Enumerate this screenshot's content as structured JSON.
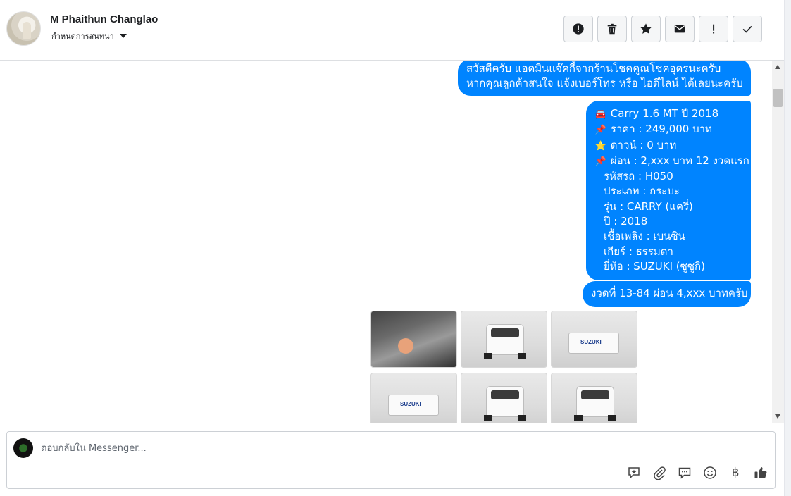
{
  "header": {
    "contact_name": "M Phaithun Changlao",
    "assign_label": "กำหนดการสนทนา"
  },
  "actions": [
    {
      "name": "report-spam-button",
      "icon": "alert-circle-icon"
    },
    {
      "name": "delete-button",
      "icon": "trash-icon"
    },
    {
      "name": "star-button",
      "icon": "star-icon"
    },
    {
      "name": "mark-unread-button",
      "icon": "envelope-icon"
    },
    {
      "name": "important-button",
      "icon": "exclamation-icon"
    },
    {
      "name": "mark-done-button",
      "icon": "check-icon"
    }
  ],
  "messages": {
    "greeting": [
      "สวัสดีครับ แอดมินแจ๊คกี้จากร้านโชคคูณโชคอุดรนะครับ",
      "หากคุณลูกค้าสนใจ แจ้งเบอร์โทร หรือ ไอดีไลน์ ได้เลยนะครับ"
    ],
    "listing": [
      {
        "emoji": "🚘",
        "text": "Carry 1.6 MT  ปี 2018"
      },
      {
        "emoji": "📌",
        "text": "ราคา : 249,000 บาท"
      },
      {
        "emoji": "⭐",
        "text": "ดาวน์ : 0 บาท"
      },
      {
        "emoji": "📌",
        "text": "ผ่อน : 2,xxx บาท 12 งวดแรก"
      },
      {
        "emoji": "",
        "text": "รหัสรถ : H050"
      },
      {
        "emoji": "",
        "text": "ประเภท : กระบะ"
      },
      {
        "emoji": "",
        "text": "รุ่น : CARRY (แครี่)"
      },
      {
        "emoji": "",
        "text": "ปี : 2018"
      },
      {
        "emoji": "",
        "text": "เชื้อเพลิง : เบนซิน"
      },
      {
        "emoji": "",
        "text": "เกียร์ : ธรรมดา"
      },
      {
        "emoji": "",
        "text": "ยี่ห้อ : SUZUKI (ซูซูกิ)"
      }
    ],
    "installment": "งวดที่ 13-84 ผ่อน 4,xxx บาทครับ"
  },
  "photos": [
    {
      "type": "engine"
    },
    {
      "type": "front"
    },
    {
      "type": "rear",
      "label": "SUZUKI"
    },
    {
      "type": "rear",
      "label": "SUZUKI"
    },
    {
      "type": "front"
    },
    {
      "type": "front"
    }
  ],
  "composer": {
    "placeholder": "ตอบกลับใน Messenger...",
    "tools": [
      "saved-reply-icon",
      "attachment-icon",
      "chat-bubble-icon",
      "emoji-icon",
      "baht-icon",
      "thumbs-up-icon"
    ],
    "baht_symbol": "฿"
  },
  "colors": {
    "bubble": "#0084ff",
    "border": "#ccd0d5"
  }
}
